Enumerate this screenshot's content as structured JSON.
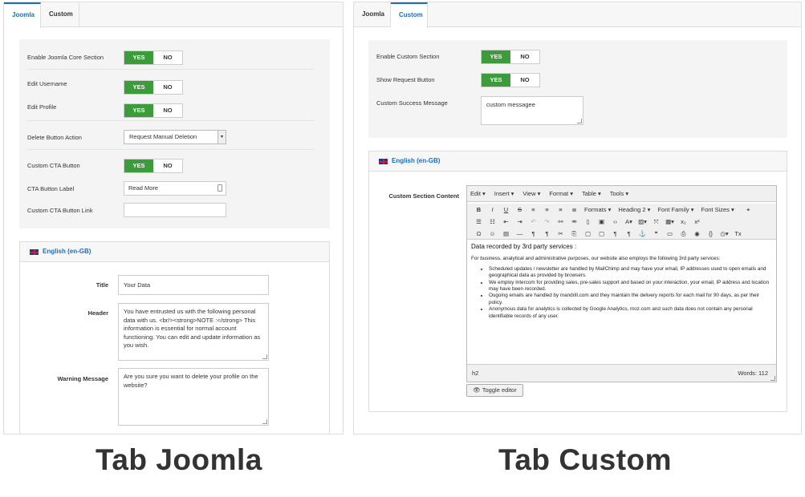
{
  "left": {
    "tabs": [
      "Joomla",
      "Custom"
    ],
    "rows": [
      {
        "label": "Enable Joomla Core Section",
        "yes": "YES",
        "no": "NO"
      },
      {
        "label": "Edit Username",
        "yes": "YES",
        "no": "NO"
      },
      {
        "label": "Edit Profile",
        "yes": "YES",
        "no": "NO"
      },
      {
        "label": "Delete Button Action",
        "value": "Request Manual Deletion"
      },
      {
        "label": "Custom CTA Button",
        "yes": "YES",
        "no": "NO"
      },
      {
        "label": "CTA Button Label",
        "value": "Read More"
      },
      {
        "label": "Custom CTA Button Link",
        "value": ""
      }
    ],
    "lang": "English (en-GB)",
    "fields": {
      "title_label": "Title",
      "title_value": "Your Data",
      "header_label": "Header",
      "header_value": "You have entrusted us with the following personal data with us. <br/><strong>NOTE :</strong> This information is essential for normal account functioning. You can edit and update information as you wish.",
      "warning_label": "Warning Message",
      "warning_value": "Are you sure you want to delete your profile on the website?"
    },
    "caption": "Tab Joomla"
  },
  "right": {
    "tabs": [
      "Joomla",
      "Custom"
    ],
    "rows": [
      {
        "label": "Enable Custom Section",
        "yes": "YES",
        "no": "NO"
      },
      {
        "label": "Show Request Button",
        "yes": "YES",
        "no": "NO"
      },
      {
        "label": "Custom Success Message",
        "value": "custom messagee"
      }
    ],
    "lang": "English (en-GB)",
    "content_label": "Custom Section Content",
    "editor": {
      "menu": [
        "Edit ▾",
        "Insert ▾",
        "View ▾",
        "Format ▾",
        "Table ▾",
        "Tools ▾"
      ],
      "formats": "Formats",
      "heading": "Heading 2",
      "fontfamily": "Font Family",
      "fontsizes": "Font Sizes",
      "h2": "Data recorded by 3rd party services :",
      "intro": "For business, analytical and administrative purposes, our website also employs the following 3rd party services:",
      "items": [
        "Scheduled updates / newsletter are handled by MailChimp and may have your email, IP addresses used to open emails and geographical data as provided by browsers.",
        "We employ Intercom for providing sales, pre-sales support and based on your interaction, your email, IP address and location may have been recorded.",
        "Ougoing emails are handled by mandrill.com and they maintain the delivery reports for each mail for 90 days, as per their policy.",
        "Anonymous data for analytics is collected by Google Analytics, moz.com and such data does not contain any personal identifiable records of any user."
      ],
      "path": "h2",
      "words": "Words: 112"
    },
    "toggle_editor": "Toggle editor",
    "caption": "Tab Custom"
  }
}
